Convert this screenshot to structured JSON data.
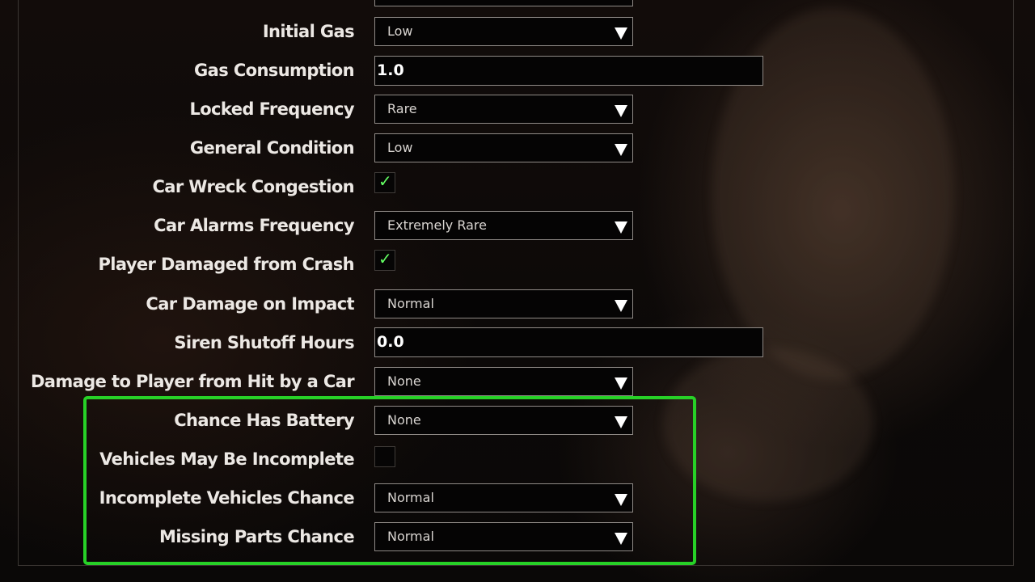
{
  "settings": [
    {
      "label": "Initial Gas",
      "type": "dropdown",
      "value": "Low"
    },
    {
      "label": "Gas Consumption",
      "type": "text",
      "value": "1.0"
    },
    {
      "label": "Locked Frequency",
      "type": "dropdown",
      "value": "Rare"
    },
    {
      "label": "General Condition",
      "type": "dropdown",
      "value": "Low"
    },
    {
      "label": "Car Wreck Congestion",
      "type": "checkbox",
      "checked": true,
      "mark": "✓"
    },
    {
      "label": "Car Alarms Frequency",
      "type": "dropdown",
      "value": "Extremely Rare"
    },
    {
      "label": "Player Damaged from Crash",
      "type": "checkbox",
      "checked": true,
      "mark": "✓"
    },
    {
      "label": "Car Damage on Impact",
      "type": "dropdown",
      "value": "Normal"
    },
    {
      "label": "Siren Shutoff Hours",
      "type": "text",
      "value": "0.0"
    },
    {
      "label": "Damage to Player from Hit by a Car",
      "type": "dropdown",
      "value": "None"
    },
    {
      "label": "Chance Has Battery",
      "type": "dropdown",
      "value": "None"
    },
    {
      "label": "Vehicles May Be Incomplete",
      "type": "checkbox",
      "checked": false,
      "mark": ""
    },
    {
      "label": "Incomplete Vehicles Chance",
      "type": "dropdown",
      "value": "Normal"
    },
    {
      "label": "Missing Parts Chance",
      "type": "dropdown",
      "value": "Normal"
    }
  ],
  "highlight": {
    "color": "#27d127",
    "first_setting": "Chance Has Battery",
    "last_setting": "Missing Parts Chance"
  },
  "icons": {
    "dropdown": "triangle-down-icon",
    "check": "checkmark-icon"
  },
  "colors": {
    "check_mark": "#63ff63",
    "label_text": "#ece8e4",
    "field_border": "#8f8a86"
  }
}
